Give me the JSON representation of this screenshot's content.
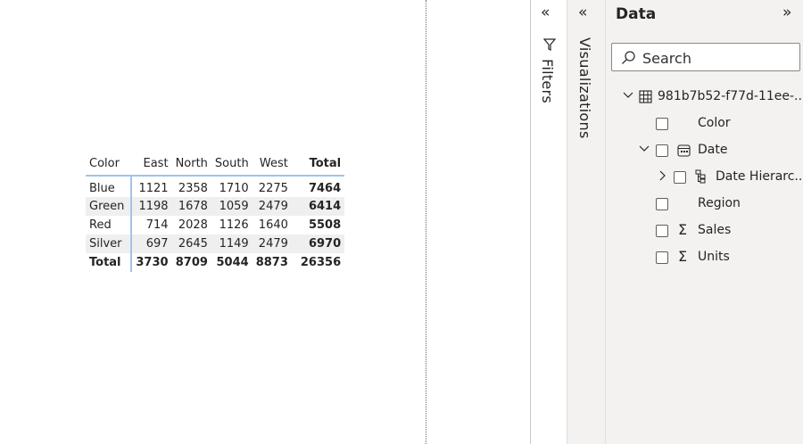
{
  "matrix": {
    "headers": [
      "Color",
      "East",
      "North",
      "South",
      "West",
      "Total"
    ],
    "rows": [
      {
        "label": "Blue",
        "values": [
          "1121",
          "2358",
          "1710",
          "2275"
        ],
        "total": "7464"
      },
      {
        "label": "Green",
        "values": [
          "1198",
          "1678",
          "1059",
          "2479"
        ],
        "total": "6414"
      },
      {
        "label": "Red",
        "values": [
          "714",
          "2028",
          "1126",
          "1640"
        ],
        "total": "5508"
      },
      {
        "label": "Silver",
        "values": [
          "697",
          "2645",
          "1149",
          "2479"
        ],
        "total": "6970"
      }
    ],
    "total_row": {
      "label": "Total",
      "values": [
        "3730",
        "8709",
        "5044",
        "8873"
      ],
      "total": "26356"
    }
  },
  "filters_pane": {
    "label": "Filters",
    "icon": "filter-icon",
    "collapse_icon": "double-chevron-left-icon"
  },
  "visualizations_pane": {
    "label": "Visualizations",
    "collapse_icon": "double-chevron-left-icon"
  },
  "data_pane": {
    "title": "Data",
    "collapse_icon": "double-chevron-right-icon",
    "search_placeholder": "Search",
    "table_name": "981b7b52-f77d-11ee-...",
    "fields": [
      {
        "label": "Color",
        "icon": "none"
      },
      {
        "label": "Date",
        "icon": "calendar-icon"
      },
      {
        "label": "Date Hierarc...",
        "icon": "hierarchy-icon"
      },
      {
        "label": "Region",
        "icon": "none"
      },
      {
        "label": "Sales",
        "icon": "sigma-icon"
      },
      {
        "label": "Units",
        "icon": "sigma-icon"
      }
    ]
  },
  "colors": {
    "accent": "#9ec5eb",
    "pane_bg": "#f3f2f1",
    "alt_row": "#efefef"
  }
}
